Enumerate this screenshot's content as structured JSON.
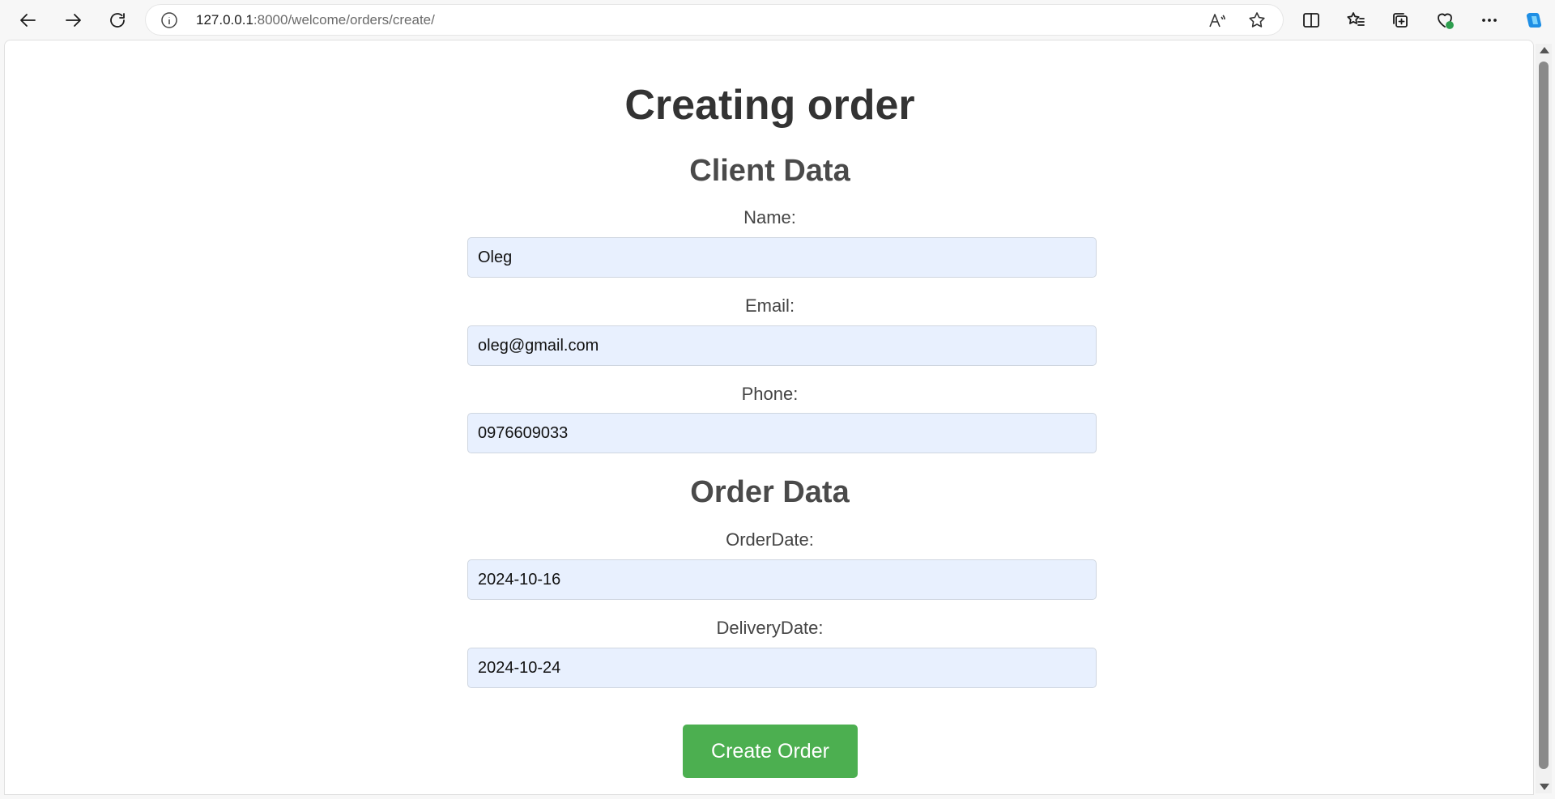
{
  "browser": {
    "url_host": "127.0.0.1",
    "url_rest": ":8000/welcome/orders/create/",
    "icons": [
      "back-arrow-icon",
      "forward-arrow-icon",
      "refresh-icon",
      "info-icon",
      "read-aloud-icon",
      "favorite-star-icon",
      "split-screen-icon",
      "favorites-list-icon",
      "collections-icon",
      "browser-essentials-icon",
      "more-options-icon",
      "copilot-icon"
    ]
  },
  "page": {
    "title": "Creating order",
    "client_section": {
      "heading": "Client Data",
      "name_label": "Name:",
      "name_value": "Oleg",
      "email_label": "Email:",
      "email_value": "oleg@gmail.com",
      "phone_label": "Phone:",
      "phone_value": "0976609033"
    },
    "order_section": {
      "heading": "Order Data",
      "order_date_label": "OrderDate:",
      "order_date_value": "2024-10-16",
      "delivery_date_label": "DeliveryDate:",
      "delivery_date_value": "2024-10-24"
    },
    "submit_label": "Create Order"
  },
  "colors": {
    "input_background": "#e8f0fe",
    "button_background": "#4caf50",
    "heading_text": "#333333"
  }
}
